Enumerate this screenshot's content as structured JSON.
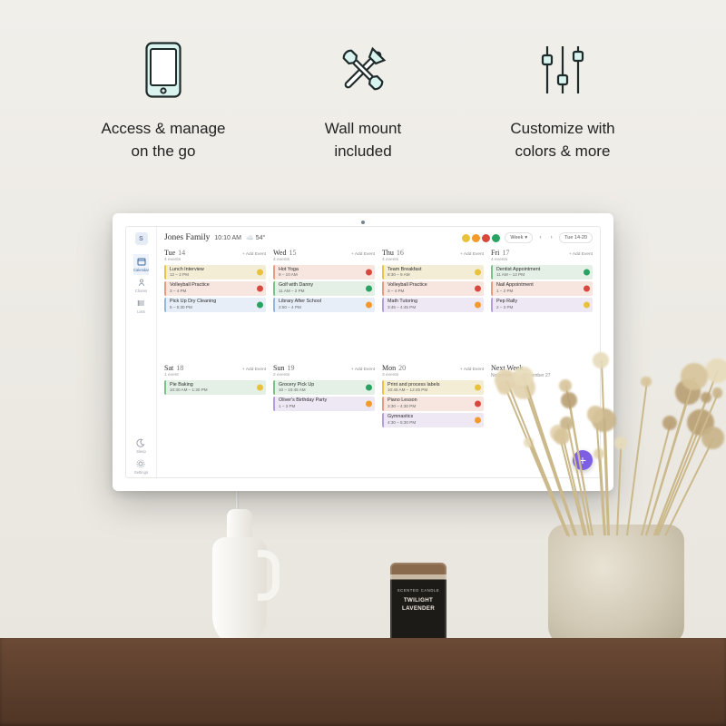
{
  "features": [
    {
      "icon": "phone",
      "line1": "Access & manage",
      "line2": "on the go"
    },
    {
      "icon": "tools",
      "line1": "Wall mount",
      "line2": "included"
    },
    {
      "icon": "sliders",
      "line1": "Customize with",
      "line2": "colors & more"
    }
  ],
  "sidebar": {
    "logo": "S",
    "items": [
      {
        "icon": "calendar",
        "label": "Calendar",
        "active": true
      },
      {
        "icon": "chores",
        "label": "Chores",
        "active": false
      },
      {
        "icon": "lists",
        "label": "Lists",
        "active": false
      }
    ],
    "bottom": [
      {
        "icon": "sleep",
        "label": "Sleep"
      },
      {
        "icon": "settings",
        "label": "Settings"
      }
    ]
  },
  "header": {
    "family": "Jones Family",
    "time": "10:10 AM",
    "weather_icon": "☁️",
    "temp": "54°",
    "avatars": [
      "#e8c23a",
      "#f39a2b",
      "#d8483f",
      "#2aa262"
    ],
    "range_label": "Week",
    "date_label": "Tue 14-20"
  },
  "add_event_label": "+ Add Event",
  "days": [
    {
      "name": "Tue",
      "num": "14",
      "count": "4 events",
      "events": [
        {
          "title": "Lunch Interview",
          "time": "12 – 2 PM",
          "bg": "#f4edd6",
          "bar": "#e4c64a",
          "av": "#e8c23a"
        },
        {
          "title": "Volleyball Practice",
          "time": "3 – 4 PM",
          "bg": "#f7e6e0",
          "bar": "#e89c83",
          "av": "#d8483f"
        },
        {
          "title": "Pick Up Dry Cleaning",
          "time": "5 – 5:30 PM",
          "bg": "#e7eef7",
          "bar": "#97b6dc",
          "av": "#2aa262"
        }
      ]
    },
    {
      "name": "Wed",
      "num": "15",
      "count": "4 events",
      "events": [
        {
          "title": "Hot Yoga",
          "time": "9 – 10 AM",
          "bg": "#f7e6e0",
          "bar": "#e89c83",
          "av": "#d8483f"
        },
        {
          "title": "Golf with Danny",
          "time": "11 AM – 2 PM",
          "bg": "#e4f0e6",
          "bar": "#7fbf8b",
          "av": "#2aa262"
        },
        {
          "title": "Library After School",
          "time": "2:50 – 4 PM",
          "bg": "#e7eef7",
          "bar": "#97b6dc",
          "av": "#f39a2b"
        }
      ]
    },
    {
      "name": "Thu",
      "num": "16",
      "count": "4 events",
      "events": [
        {
          "title": "Team Breakfast",
          "time": "8:30 – 9 AM",
          "bg": "#f4edd6",
          "bar": "#e4c64a",
          "av": "#e8c23a"
        },
        {
          "title": "Volleyball Practice",
          "time": "3 – 4 PM",
          "bg": "#f7e6e0",
          "bar": "#e89c83",
          "av": "#d8483f"
        },
        {
          "title": "Math Tutoring",
          "time": "3:45 – 4:45 PM",
          "bg": "#eee8f5",
          "bar": "#b49fd8",
          "av": "#f39a2b"
        }
      ]
    },
    {
      "name": "Fri",
      "num": "17",
      "count": "4 events",
      "events": [
        {
          "title": "Dentist Appointment",
          "time": "11 AM – 12 PM",
          "bg": "#e4f0e6",
          "bar": "#7fbf8b",
          "av": "#2aa262"
        },
        {
          "title": "Nail Appointment",
          "time": "1 – 2 PM",
          "bg": "#f7e6e0",
          "bar": "#e89c83",
          "av": "#d8483f"
        },
        {
          "title": "Pep Rally",
          "time": "2 – 3 PM",
          "bg": "#eee8f5",
          "bar": "#b49fd8",
          "av": "#e8c23a"
        }
      ]
    },
    {
      "name": "Sat",
      "num": "18",
      "count": "1 event",
      "events": [
        {
          "title": "Pie Baking",
          "time": "10:30 AM – 1:30 PM",
          "bg": "#e4f0e6",
          "bar": "#7fbf8b",
          "av": "#e8c23a"
        }
      ]
    },
    {
      "name": "Sun",
      "num": "19",
      "count": "2 events",
      "events": [
        {
          "title": "Grocery Pick Up",
          "time": "10 – 10:45 AM",
          "bg": "#e4f0e6",
          "bar": "#7fbf8b",
          "av": "#2aa262"
        },
        {
          "title": "Oliver's Birthday Party",
          "time": "1 – 3 PM",
          "bg": "#eee8f5",
          "bar": "#b49fd8",
          "av": "#f39a2b"
        }
      ]
    },
    {
      "name": "Mon",
      "num": "20",
      "count": "3 events",
      "events": [
        {
          "title": "Print and process labels",
          "time": "10:45 AM – 12:45 PM",
          "bg": "#f4edd6",
          "bar": "#e4c64a",
          "av": "#e8c23a"
        },
        {
          "title": "Piano Lesson",
          "time": "3:30 – 4:30 PM",
          "bg": "#f7e6e0",
          "bar": "#e89c83",
          "av": "#d8483f"
        },
        {
          "title": "Gymnastics",
          "time": "4:30 – 5:30 PM",
          "bg": "#eee8f5",
          "bar": "#b49fd8",
          "av": "#f39a2b"
        }
      ]
    }
  ],
  "next_week": {
    "title": "Next Week",
    "range": "November 21 – November 27"
  },
  "fab": "+",
  "candle": {
    "brand": "SCENTED CANDLE",
    "name": "TWILIGHT\nLAVENDER"
  }
}
